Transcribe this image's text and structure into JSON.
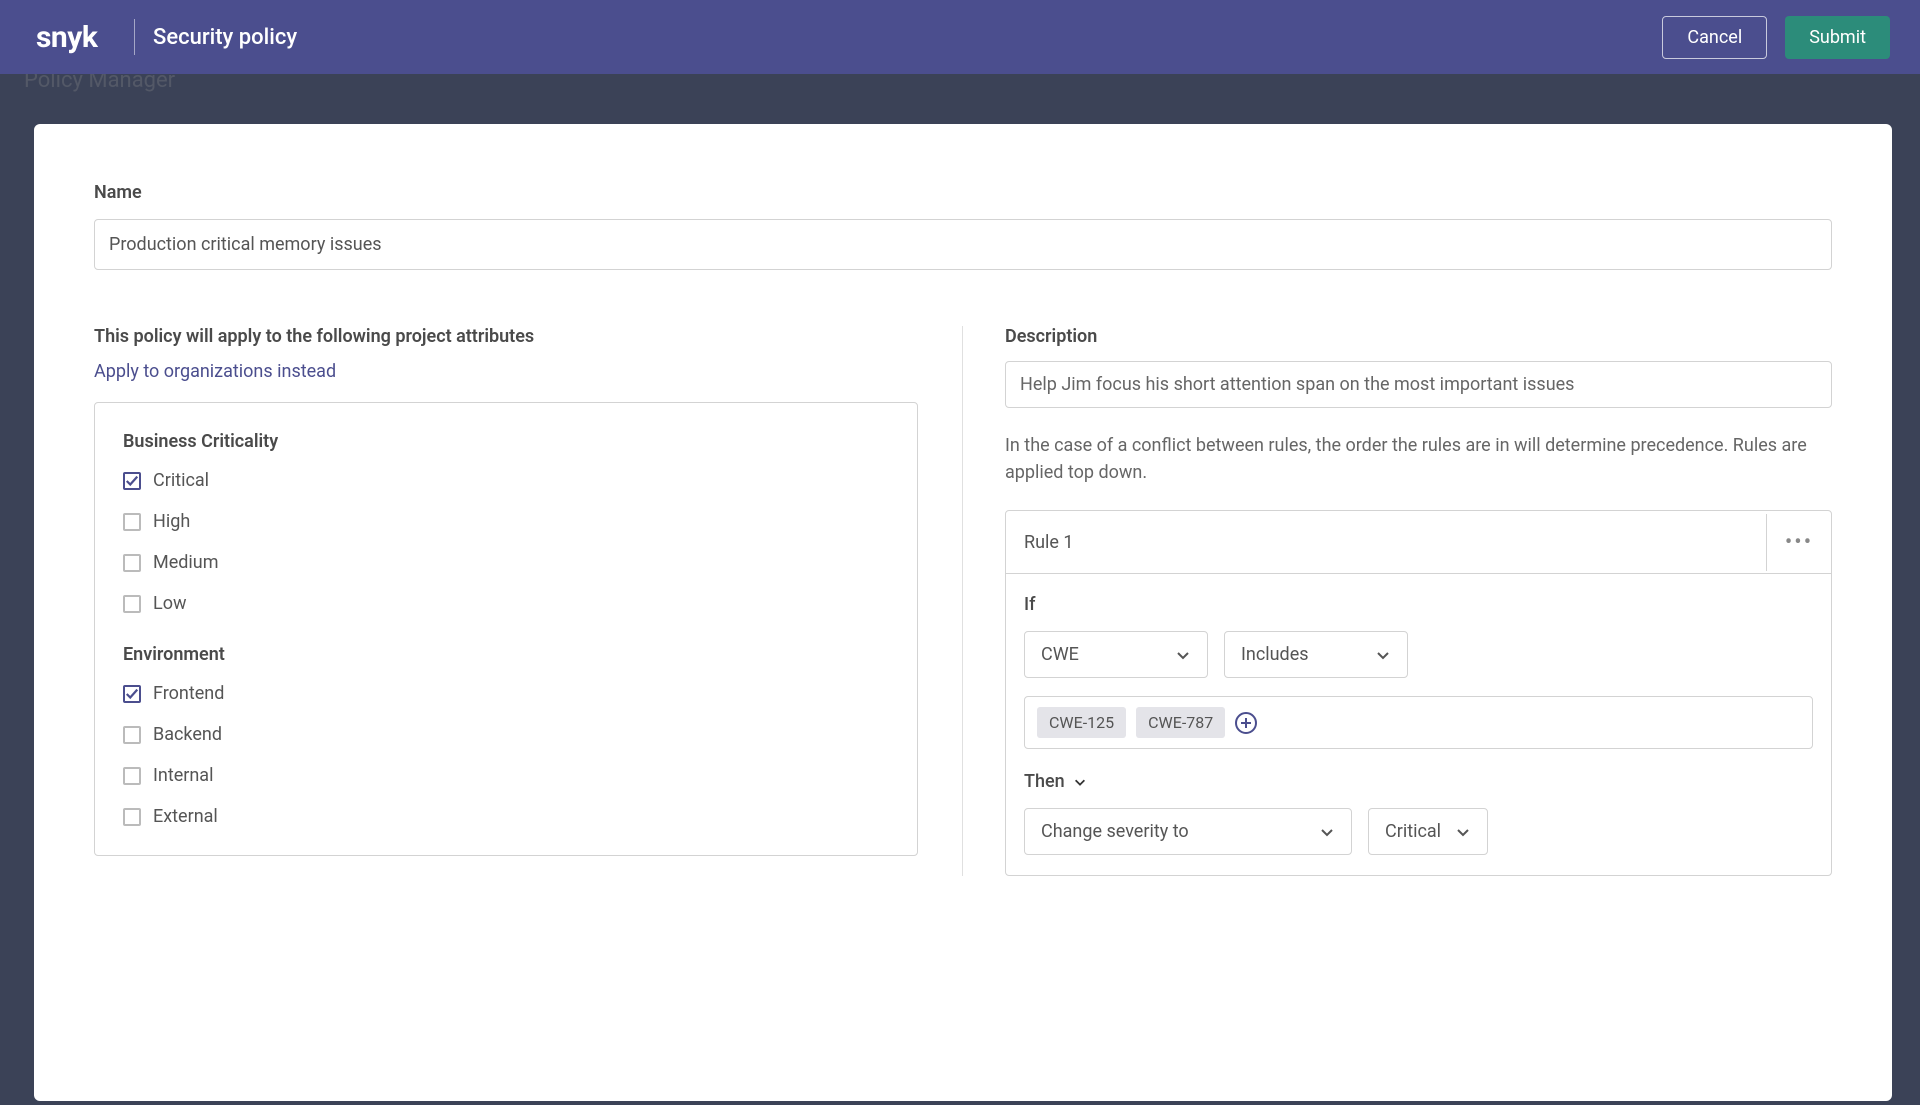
{
  "header": {
    "logo": "snyk",
    "title": "Security policy",
    "cancel": "Cancel",
    "submit": "Submit"
  },
  "shadow": "Policy Manager",
  "form": {
    "name_label": "Name",
    "name_value": "Production critical memory issues"
  },
  "left": {
    "heading": "This policy will apply to the following project attributes",
    "link": "Apply to organizations instead",
    "groups": [
      {
        "title": "Business Criticality",
        "options": [
          {
            "label": "Critical",
            "checked": true
          },
          {
            "label": "High",
            "checked": false
          },
          {
            "label": "Medium",
            "checked": false
          },
          {
            "label": "Low",
            "checked": false
          }
        ]
      },
      {
        "title": "Environment",
        "options": [
          {
            "label": "Frontend",
            "checked": true
          },
          {
            "label": "Backend",
            "checked": false
          },
          {
            "label": "Internal",
            "checked": false
          },
          {
            "label": "External",
            "checked": false
          }
        ]
      }
    ]
  },
  "right": {
    "desc_label": "Description",
    "desc_value": "Help Jim focus his short attention span on the most important issues",
    "hint": "In the case of a conflict between rules, the order the rules are in will determine precedence. Rules are applied top down.",
    "rule": {
      "title": "Rule 1",
      "if_label": "If",
      "cond_field": "CWE",
      "cond_op": "Includes",
      "tags": [
        "CWE-125",
        "CWE-787"
      ],
      "then_label": "Then",
      "action": "Change severity to",
      "action_value": "Critical"
    }
  }
}
